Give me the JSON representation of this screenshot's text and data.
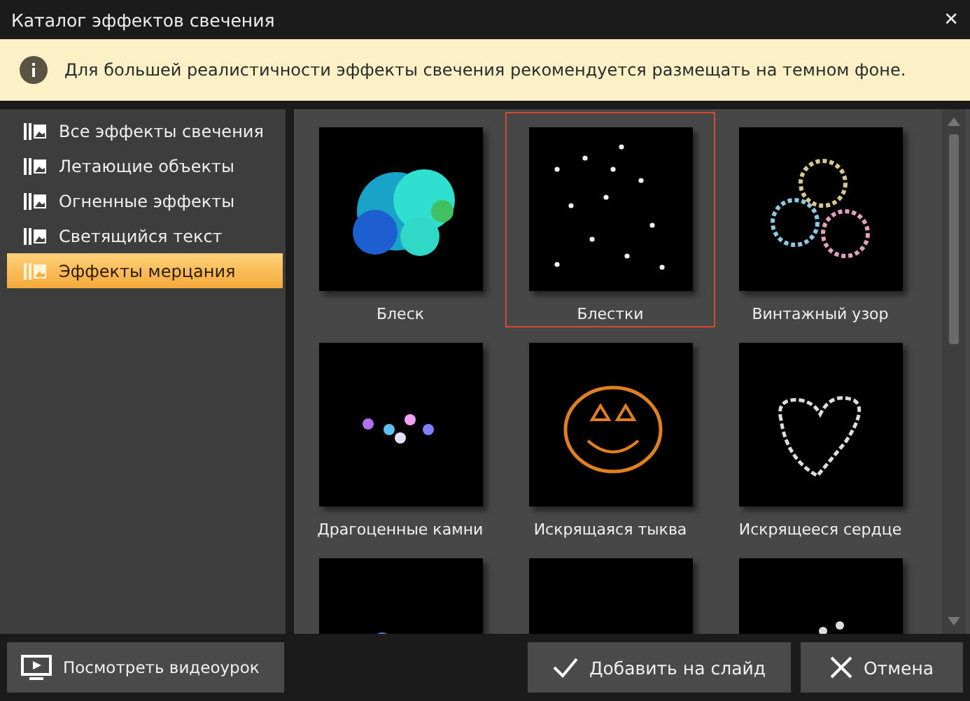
{
  "window": {
    "title": "Каталог эффектов свечения",
    "close": "✕"
  },
  "banner": {
    "text": "Для большей реалистичности эффекты свечения рекомендуется размещать на темном фоне."
  },
  "sidebar": {
    "items": [
      {
        "label": "Все эффекты свечения",
        "selected": false
      },
      {
        "label": "Летающие объекты",
        "selected": false
      },
      {
        "label": "Огненные эффекты",
        "selected": false
      },
      {
        "label": "Светящийся текст",
        "selected": false
      },
      {
        "label": "Эффекты мерцания",
        "selected": true
      }
    ]
  },
  "gallery": {
    "items": [
      {
        "label": "Блеск",
        "selected": false
      },
      {
        "label": "Блестки",
        "selected": true
      },
      {
        "label": "Винтажный узор",
        "selected": false
      },
      {
        "label": "Драгоценные камни",
        "selected": false
      },
      {
        "label": "Искрящаяся тыква",
        "selected": false
      },
      {
        "label": "Искрящееся сердце",
        "selected": false
      },
      {
        "selected": false
      },
      {
        "selected": false
      },
      {
        "selected": false
      }
    ]
  },
  "footer": {
    "tutorial_button": "Посмотреть видеоурок",
    "add_button": "Добавить на слайд",
    "cancel_button": "Отмена"
  }
}
